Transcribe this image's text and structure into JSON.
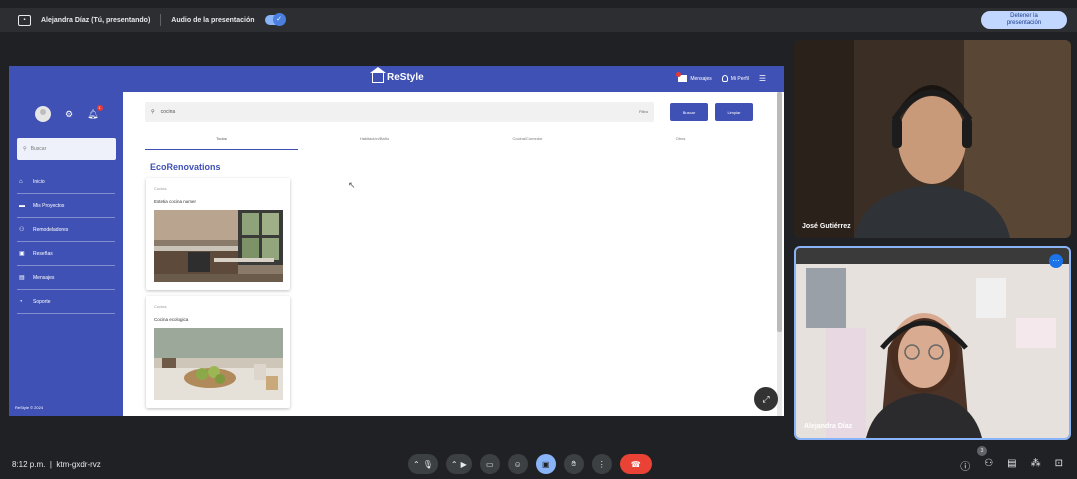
{
  "topbar": {
    "presenter_label": "Alejandra Díaz (Tú, presentando)",
    "audio_label": "Audio de la presentación",
    "stop_line1": "Detener la",
    "stop_line2": "presentación"
  },
  "app": {
    "brand": "ReStyle",
    "header_messages": "Mensajes",
    "header_profile": "Mi Perfil",
    "sidebar_search_placeholder": "Buscar",
    "sidebar_items": [
      {
        "label": "Inicio",
        "icon": "home-icon"
      },
      {
        "label": "Mis Proyectos",
        "icon": "folder-icon"
      },
      {
        "label": "Remodeladores",
        "icon": "people-icon"
      },
      {
        "label": "Reseñas",
        "icon": "review-icon"
      },
      {
        "label": "Mensajes",
        "icon": "message-icon"
      },
      {
        "label": "Soporte",
        "icon": "support-icon"
      }
    ],
    "footer": "ReStyle © 2024",
    "search_value": "cocina",
    "filter_label": "Filtro",
    "search_button": "Buscar",
    "clear_button": "Limpiar",
    "tabs": [
      "Todos",
      "Habitación/Baño",
      "Cocina/Comedor",
      "Otros"
    ],
    "company": "EcoRenovations",
    "cards": [
      {
        "category": "Cocina",
        "title": "Estetia cocina numer"
      },
      {
        "category": "Cocina",
        "title": "Cocina ecologica"
      }
    ]
  },
  "participants": [
    {
      "name": "José Gutiérrez"
    },
    {
      "name": "Alejandra Díaz"
    }
  ],
  "bottom": {
    "time": "8:12 p.m.",
    "meeting_code": "ktm-gxdr-rvz",
    "participant_count": "3"
  }
}
